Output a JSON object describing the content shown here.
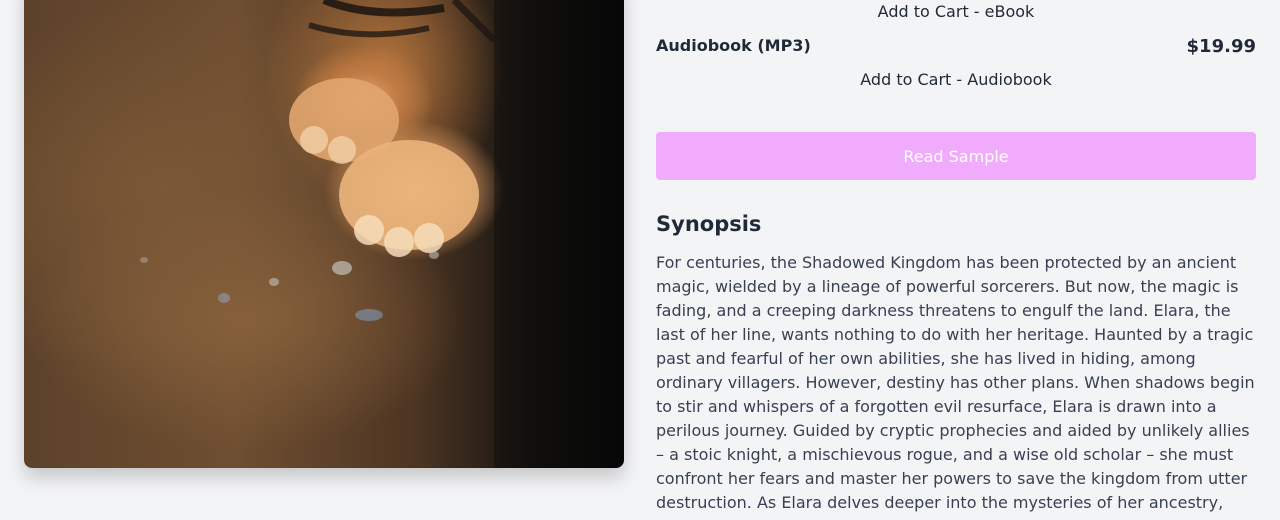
{
  "cover": {
    "image_name": "tiger-cover-image"
  },
  "purchase": {
    "ebook_cart_label": "Add to Cart - eBook",
    "audiobook_format": "Audiobook (MP3)",
    "audiobook_price": "$19.99",
    "audiobook_cart_label": "Add to Cart - Audiobook",
    "read_sample_label": "Read Sample"
  },
  "synopsis": {
    "heading": "Synopsis",
    "text": "For centuries, the Shadowed Kingdom has been protected by an ancient magic, wielded by a lineage of powerful sorcerers. But now, the magic is fading, and a creeping darkness threatens to engulf the land. Elara, the last of her line, wants nothing to do with her heritage. Haunted by a tragic past and fearful of her own abilities, she has lived in hiding, among ordinary villagers. However, destiny has other plans. When shadows begin to stir and whispers of a forgotten evil resurface, Elara is drawn into a perilous journey. Guided by cryptic prophecies and aided by unlikely allies – a stoic knight, a mischievous rogue, and a wise old scholar – she must confront her fears and master her powers to save the kingdom from utter destruction. As Elara delves deeper into the mysteries of her ancestry,"
  },
  "colors": {
    "accent_button": "#f0abfc",
    "background": "#f3f4f6",
    "text": "#1f2937"
  }
}
